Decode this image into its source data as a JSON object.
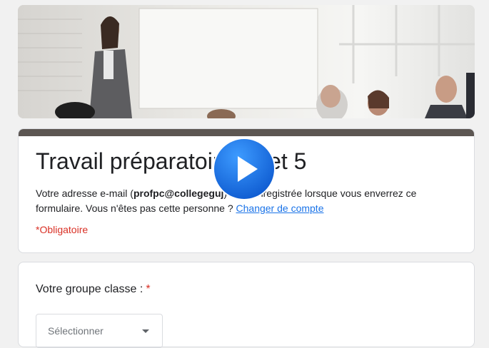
{
  "form": {
    "title": "Travail préparatoire sujet 5",
    "email_prefix": "Votre adresse e-mail (",
    "email": "profpc@collegeguj",
    "email_suffix": ") sera enregistrée lorsque vous enverrez ce formulaire. Vous n'êtes pas cette personne ? ",
    "change_account": "Changer de compte",
    "required_note": "*Obligatoire"
  },
  "question": {
    "label": "Votre groupe classe :",
    "required_mark": "*",
    "select_placeholder": "Sélectionner"
  },
  "colors": {
    "accent_bar": "#5c5652",
    "required": "#d93025",
    "link": "#1a73e8",
    "play_button": "#1a6fe0"
  },
  "icons": {
    "play": "play-icon",
    "dropdown": "chevron-down-icon"
  }
}
